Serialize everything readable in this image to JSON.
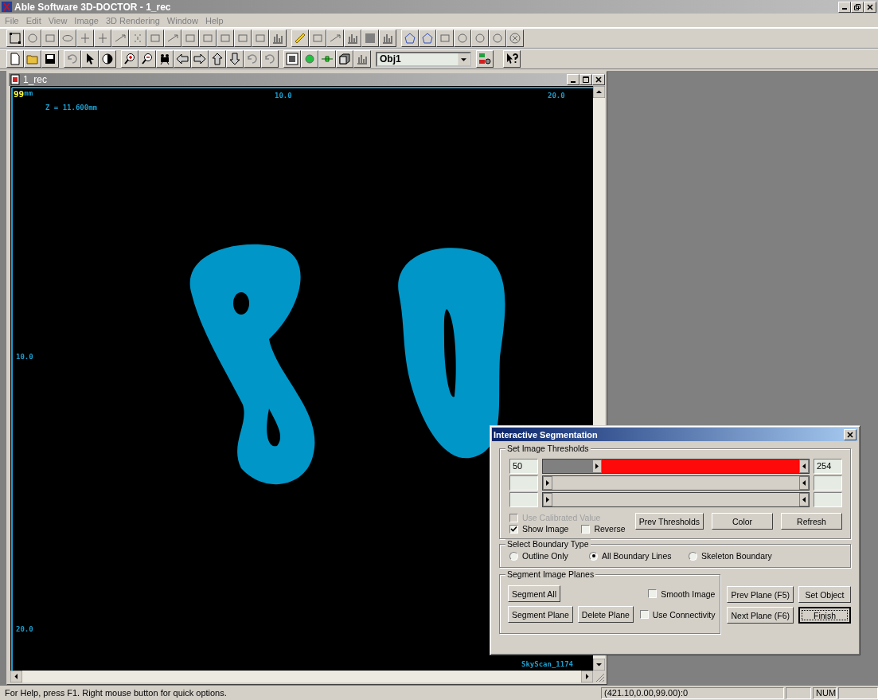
{
  "window": {
    "title": "Able Software 3D-DOCTOR - 1_rec"
  },
  "menu": [
    "File",
    "Edit",
    "View",
    "Image",
    "3D Rendering",
    "Window",
    "Help"
  ],
  "toolbar": {
    "object_combo": "Obj1"
  },
  "document": {
    "title": "1_rec",
    "slice": "99",
    "unit": "mm",
    "top_ticks": [
      "10.0",
      "20.0"
    ],
    "left_ticks": [
      "10.0",
      "20.0"
    ],
    "z_position": "Z = 11.600mm",
    "scanner": "SkyScan_1174"
  },
  "dialog": {
    "title": "Interactive Segmentation",
    "thresholds": {
      "label": "Set Image Thresholds",
      "sliders": [
        {
          "low": "50",
          "high": "254",
          "highlighted": true,
          "thumbs": [
            {
              "level": 0.2
            },
            {
              "level": 1
            }
          ]
        },
        {
          "highlighted": false,
          "thumbs": [
            {
              "level": 0
            },
            {
              "level": 1
            }
          ]
        },
        {
          "highlighted": false,
          "thumbs": [
            {
              "level": 0
            },
            {
              "level": 1
            }
          ]
        }
      ],
      "options": [
        {
          "label": "Use Calibrated Value",
          "checked": false,
          "disabled": true
        },
        {
          "label": "Show Image",
          "checked": true,
          "disabled": false
        },
        {
          "label": "Reverse",
          "checked": false,
          "disabled": false
        }
      ],
      "buttons": [
        "Prev Thresholds",
        "Color",
        "Refresh"
      ]
    },
    "boundary": {
      "label": "Select Boundary Type",
      "options": [
        {
          "label": "Outline Only",
          "selected": false
        },
        {
          "label": "All Boundary Lines",
          "selected": true
        },
        {
          "label": "Skeleton Boundary",
          "selected": false
        }
      ]
    },
    "planes": {
      "label": "Segment Image Planes",
      "rows": [
        {
          "buttons": [
            "Segment All"
          ],
          "option": {
            "label": "Smooth Image",
            "checked": false
          }
        },
        {
          "buttons": [
            "Segment Plane",
            "Delete Plane"
          ],
          "option": {
            "label": "Use Connectivity",
            "checked": false
          }
        }
      ]
    },
    "actions": [
      {
        "label": "Prev Plane (F5)",
        "default": false
      },
      {
        "label": "Set Object",
        "default": false
      },
      {
        "label": "Next Plane (F6)",
        "default": false
      },
      {
        "label": "Finish",
        "default": true
      }
    ]
  },
  "status_bar": {
    "message": "For Help, press F1. Right mouse button for quick options.",
    "coordinates": "(421.10,0.00,99.00):0",
    "indicator": "NUM"
  }
}
